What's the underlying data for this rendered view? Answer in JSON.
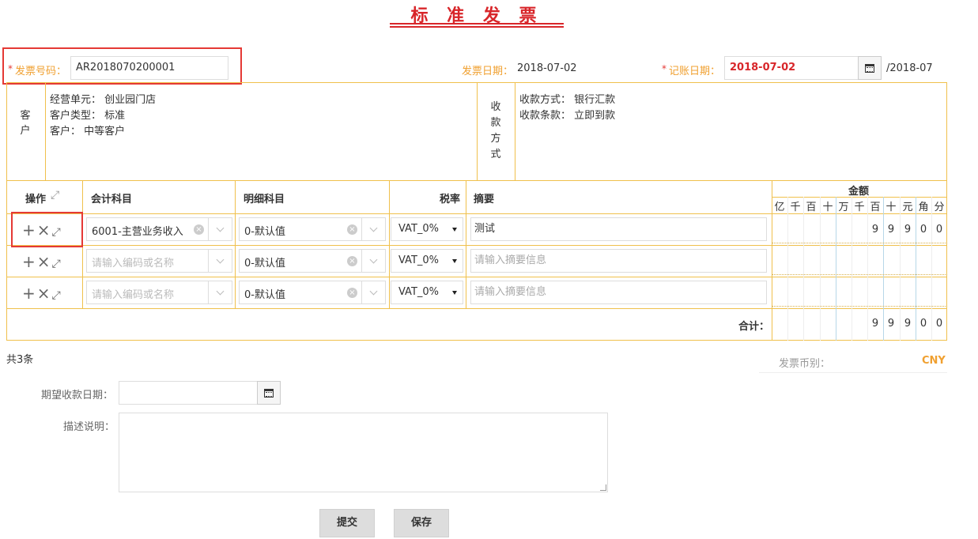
{
  "title": "标 准 发 票",
  "header": {
    "invoice_no_label": "发票号码：",
    "invoice_no": "AR2018070200001",
    "invoice_date_label": "发票日期：",
    "invoice_date": "2018-07-02",
    "posting_date_label": "记账日期：",
    "posting_date": "2018-07-02",
    "period": "/2018-07",
    "required_mark": "*"
  },
  "customer": {
    "side_label": [
      "客",
      "户"
    ],
    "lines": [
      "经营单元： 创业园门店",
      "客户类型： 标准",
      "客户： 中等客户"
    ]
  },
  "payment": {
    "side_label": [
      "收",
      "款",
      "方",
      "式"
    ],
    "lines": [
      "收款方式： 银行汇款",
      "收款条款： 立即到款"
    ]
  },
  "table": {
    "headers": {
      "ops": "操作",
      "account": "会计科目",
      "detail": "明细科目",
      "tax": "税率",
      "memo": "摘要",
      "amount": "金额"
    },
    "digit_headers": [
      "亿",
      "千",
      "百",
      "十",
      "万",
      "千",
      "百",
      "十",
      "元",
      "角",
      "分"
    ],
    "rows": [
      {
        "account": "6001-主营业务收入",
        "account_placeholder": "请输入编码或名称",
        "detail": "0-默认值",
        "tax": "VAT_0%",
        "memo": "测试",
        "memo_placeholder": "请输入摘要信息",
        "digits": [
          "",
          "",
          "",
          "",
          "",
          "",
          "9",
          "9",
          "9",
          "0",
          "0"
        ]
      },
      {
        "account": "",
        "account_placeholder": "请输入编码或名称",
        "detail": "0-默认值",
        "tax": "VAT_0%",
        "memo": "",
        "memo_placeholder": "请输入摘要信息",
        "digits": [
          "",
          "",
          "",
          "",
          "",
          "",
          "",
          "",
          "",
          "",
          ""
        ]
      },
      {
        "account": "",
        "account_placeholder": "请输入编码或名称",
        "detail": "0-默认值",
        "tax": "VAT_0%",
        "memo": "",
        "memo_placeholder": "请输入摘要信息",
        "digits": [
          "",
          "",
          "",
          "",
          "",
          "",
          "",
          "",
          "",
          "",
          ""
        ]
      }
    ],
    "total_label": "合计：",
    "total_digits": [
      "",
      "",
      "",
      "",
      "",
      "",
      "9",
      "9",
      "9",
      "0",
      "0"
    ]
  },
  "count_text": "共3条",
  "currency_label": "发票币别：",
  "currency": "CNY",
  "expected_date_label": "期望收款日期：",
  "description_label": "描述说明：",
  "buttons": {
    "submit": "提交",
    "save": "保存"
  },
  "colors": {
    "accent_red": "#d8262a",
    "frame_orange": "#f0c04c",
    "label_orange": "#f0a030"
  }
}
